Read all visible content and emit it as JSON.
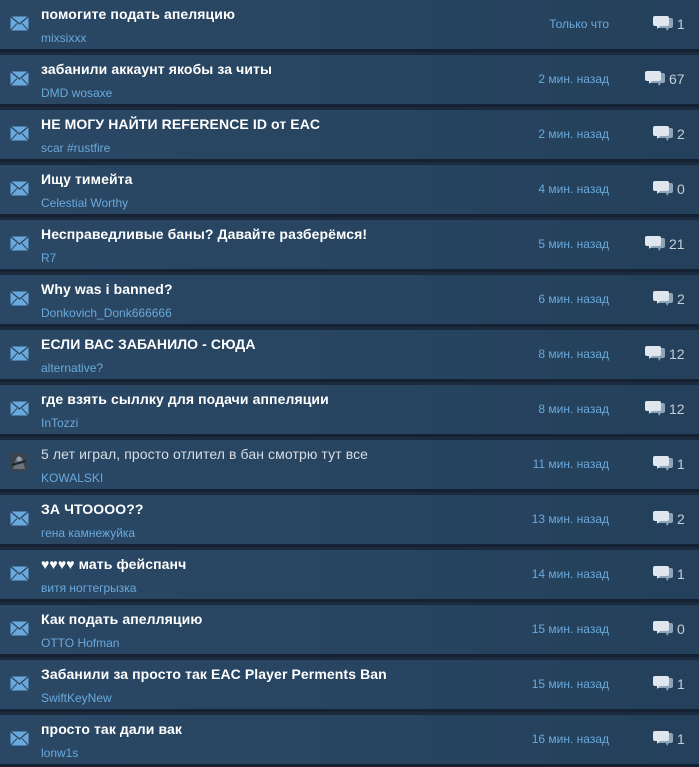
{
  "topics": [
    {
      "title": "помогите подать апеляцию",
      "author": "mixsixxx",
      "time": "Только что",
      "replies": "1",
      "icon": "envelope-icon"
    },
    {
      "title": "забанили аккаунт якобы за читы",
      "author": "DMD wosaxe",
      "time": "2 мин. назад",
      "replies": "67",
      "icon": "envelope-icon"
    },
    {
      "title": "НЕ МОГУ НАЙТИ REFERENCE ID от EAC",
      "author": "scar #rustfire",
      "time": "2 мин. назад",
      "replies": "2",
      "icon": "envelope-icon"
    },
    {
      "title": "Ищу тимейта",
      "author": "Celestial Worthy",
      "time": "4 мин. назад",
      "replies": "0",
      "icon": "envelope-icon"
    },
    {
      "title": "Несправедливые баны? Давайте разберёмся!",
      "author": "R7",
      "time": "5 мин. назад",
      "replies": "21",
      "icon": "envelope-icon"
    },
    {
      "title": "Why was i banned?",
      "author": "Donkovich_Donk666666",
      "time": "6 мин. назад",
      "replies": "2",
      "icon": "envelope-icon"
    },
    {
      "title": "ЕСЛИ ВАС ЗАБАНИЛО - СЮДА",
      "author": "alternative?",
      "time": "8 мин. назад",
      "replies": "12",
      "icon": "envelope-icon"
    },
    {
      "title": "где взять сыллку для подачи аппеляции",
      "author": "InTozzi",
      "time": "8 мин. назад",
      "replies": "12",
      "icon": "envelope-icon"
    },
    {
      "title": "5 лет играл, просто отлител в бан смотрю тут все",
      "author": "KOWALSKI",
      "time": "11 мин. назад",
      "replies": "1",
      "icon": "avatar-icon"
    },
    {
      "title": "ЗА ЧТОООО??",
      "author": "гена камнежуйка",
      "time": "13 мин. назад",
      "replies": "2",
      "icon": "envelope-icon"
    },
    {
      "title": "♥♥♥♥ мать фейспанч",
      "author": "витя ногтегрызка",
      "time": "14 мин. назад",
      "replies": "1",
      "icon": "envelope-icon"
    },
    {
      "title": "Как подать апелляцию",
      "author": "OTTO Hofman",
      "time": "15 мин. назад",
      "replies": "0",
      "icon": "envelope-icon"
    },
    {
      "title": "Забанили за просто так EAC Player Perments Ban",
      "author": "SwiftKeyNew",
      "time": "15 мин. назад",
      "replies": "1",
      "icon": "envelope-icon"
    },
    {
      "title": "просто так дали вак",
      "author": "lonw1s",
      "time": "16 мин. назад",
      "replies": "1",
      "icon": "envelope-icon"
    }
  ]
}
